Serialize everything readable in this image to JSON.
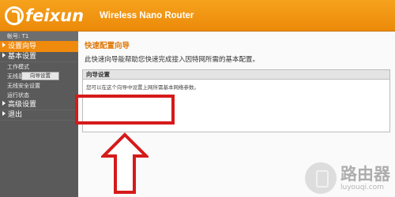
{
  "header": {
    "brand": "feixun",
    "product": "Wireless Nano Router"
  },
  "sidebar": {
    "account": "帐号: T1",
    "items": [
      {
        "label": "设置向导",
        "active": true
      },
      {
        "label": "基本设置"
      },
      {
        "label": "工作模式",
        "sub": true
      },
      {
        "label": "无线基本设置",
        "sub": true
      },
      {
        "label": "无线安全设置",
        "sub": true
      },
      {
        "label": "运行状态",
        "sub": true
      },
      {
        "label": "高级设置"
      },
      {
        "label": "退出"
      }
    ]
  },
  "main": {
    "title": "快速配置向导",
    "description": "此快速向导能帮助您快速完成接入因特网所需的基本配置。",
    "panel_title": "向导设置",
    "panel_text": "您可以在这个向导中设置上网所需基本网络参数。",
    "wizard_button": "向导设置"
  },
  "watermark": {
    "title": "路由器",
    "site": "luyouqi.com"
  },
  "colors": {
    "accent": "#f08a0c",
    "annotation": "#d61a1a"
  }
}
